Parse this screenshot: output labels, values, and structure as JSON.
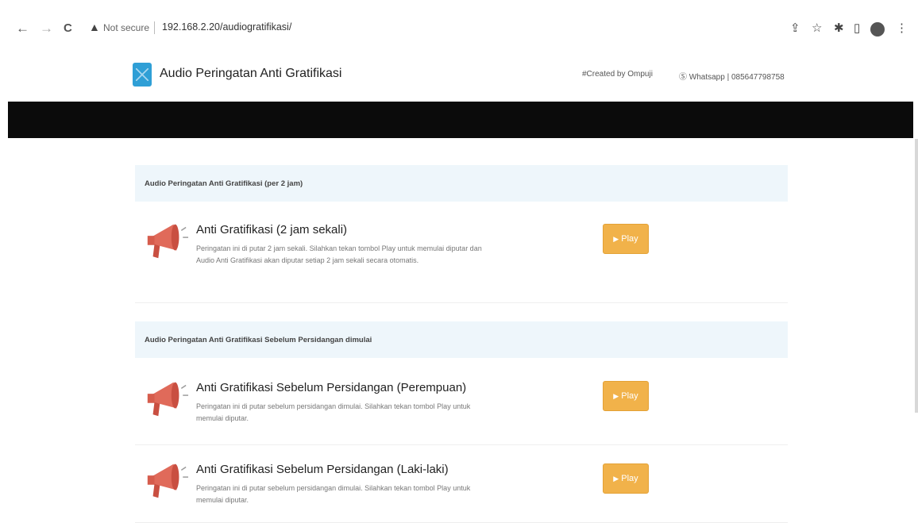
{
  "browser": {
    "nav": {
      "back": "←",
      "forward": "→",
      "reload": "C"
    },
    "security_icon": "warning-icon",
    "not_secure": "Not secure",
    "url": "192.168.2.20/audiogratifikasi/",
    "toolbar_icons": [
      "share-icon",
      "star-icon",
      "extensions-icon",
      "sidepanel-icon",
      "profile-icon",
      "menu-icon"
    ]
  },
  "header": {
    "title": "Audio Peringatan Anti Gratifikasi",
    "created_by": "#Created by Ompuji",
    "whatsapp": "Whatsapp | 085647798758"
  },
  "sections": [
    {
      "heading": "Audio Peringatan Anti Gratifikasi (per 2 jam)",
      "items": [
        {
          "title": "Anti Gratifikasi (2 jam sekali)",
          "description": "Peringatan ini di putar 2 jam sekali. Silahkan tekan tombol Play untuk memulai diputar dan Audio Anti Gratifikasi akan diputar setiap 2 jam sekali secara otomatis.",
          "button": "Play"
        }
      ]
    },
    {
      "heading": "Audio Peringatan Anti Gratifikasi Sebelum Persidangan dimulai",
      "items": [
        {
          "title": "Anti Gratifikasi Sebelum Persidangan (Perempuan)",
          "description": "Peringatan ini di putar sebelum persidangan dimulai. Silahkan tekan tombol Play untuk memulai diputar.",
          "button": "Play"
        },
        {
          "title": "Anti Gratifikasi Sebelum Persidangan (Laki-laki)",
          "description": "Peringatan ini di putar sebelum persidangan dimulai. Silahkan tekan tombol Play untuk memulai diputar.",
          "button": "Play"
        }
      ]
    }
  ],
  "colors": {
    "play_button": "#f1b24a",
    "section_header_bg": "#eef6fb",
    "megaphone": "#e06a5a",
    "banner": "#0b0b0b",
    "logo": "#2f9fd6"
  }
}
